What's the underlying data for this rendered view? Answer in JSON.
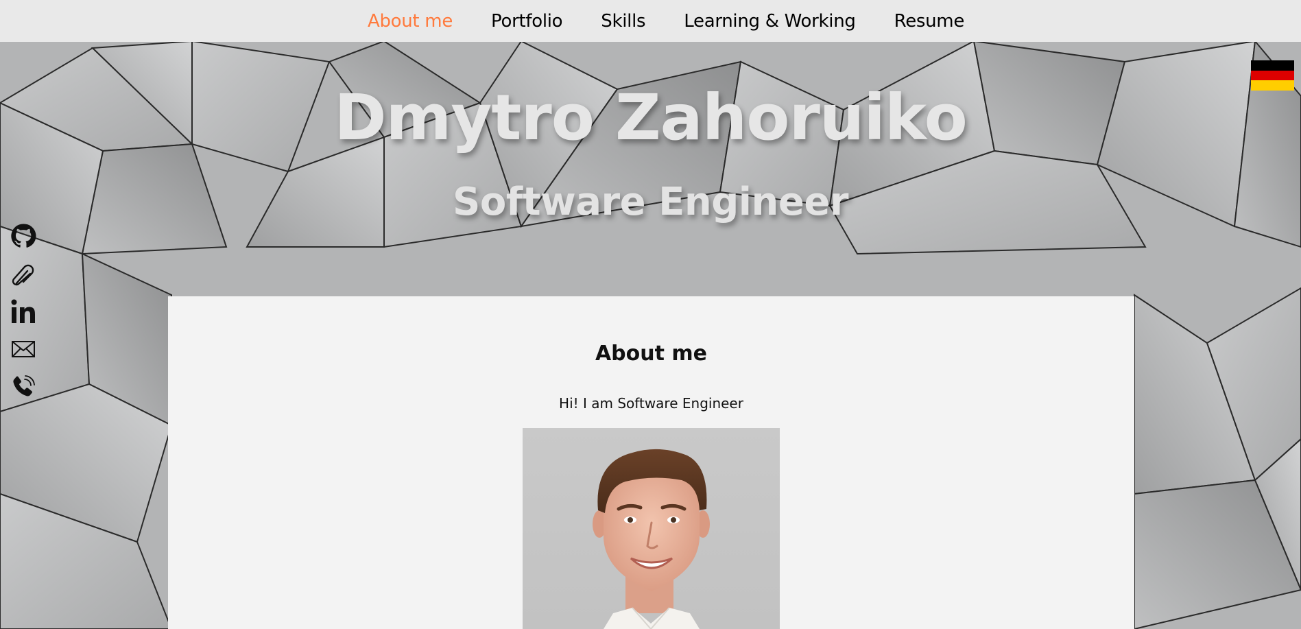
{
  "nav": {
    "items": [
      {
        "label": "About me",
        "active": true
      },
      {
        "label": "Portfolio",
        "active": false
      },
      {
        "label": "Skills",
        "active": false
      },
      {
        "label": "Learning & Working",
        "active": false
      },
      {
        "label": "Resume",
        "active": false
      }
    ],
    "active_color": "#ff7a3d"
  },
  "language_flag": {
    "icon": "german-flag-icon",
    "colors": [
      "#000000",
      "#dd0000",
      "#ffce00"
    ]
  },
  "hero": {
    "name": "Dmytro Zahoruiko",
    "title": "Software Engineer"
  },
  "social": [
    {
      "icon": "github-icon"
    },
    {
      "icon": "link-icon"
    },
    {
      "icon": "linkedin-icon"
    },
    {
      "icon": "email-icon"
    },
    {
      "icon": "phone-icon"
    }
  ],
  "about": {
    "heading": "About me",
    "intro": "Hi! I am Software Engineer",
    "photo": "profile-photo"
  }
}
